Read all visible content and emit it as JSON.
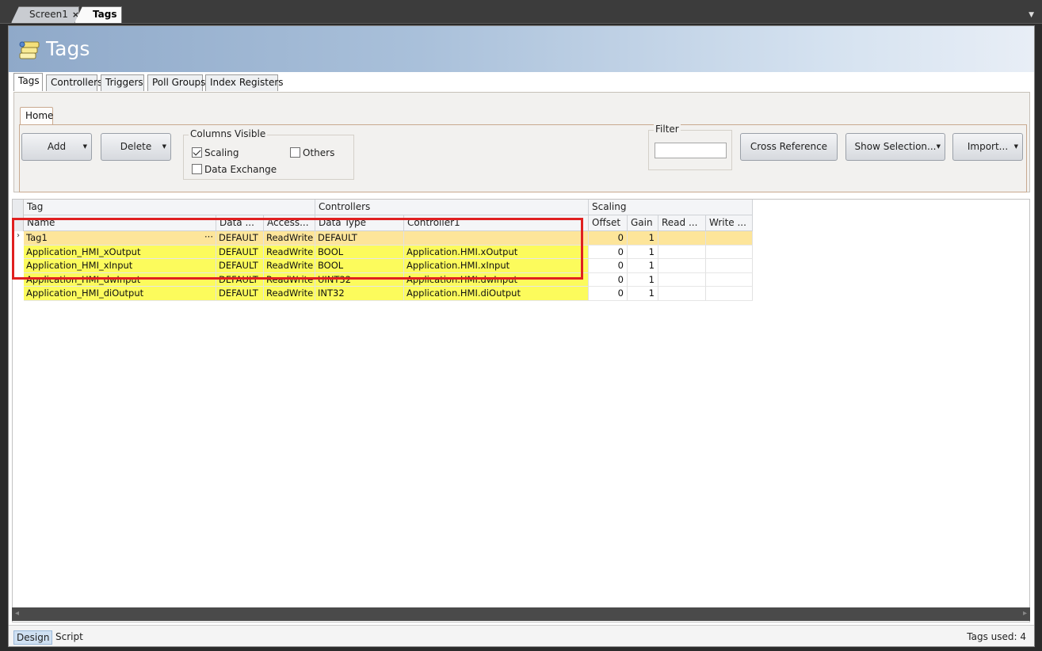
{
  "doc_tabs": [
    {
      "label": "Screen1",
      "close": "×"
    },
    {
      "label": "Tags",
      "close": "×"
    }
  ],
  "header": {
    "title": "Tags"
  },
  "inner_tabs": [
    "Tags",
    "Controllers",
    "Triggers",
    "Poll Groups",
    "Index Registers"
  ],
  "ribbon": {
    "tab": "Home",
    "add_label": "Add",
    "delete_label": "Delete",
    "columns_visible": {
      "label": "Columns Visible",
      "scaling": {
        "label": "Scaling",
        "checked": true
      },
      "others": {
        "label": "Others",
        "checked": false
      },
      "data_exchange": {
        "label": "Data Exchange",
        "checked": false
      }
    },
    "filter": {
      "label": "Filter",
      "value": ""
    },
    "cross_reference_label": "Cross Reference",
    "show_selection_label": "Show Selection...",
    "import_label": "Import..."
  },
  "grid": {
    "groups": [
      "Tag",
      "Controllers",
      "Scaling"
    ],
    "columns": [
      "Name",
      "Data ...",
      "Access...",
      "Data Type",
      "Controller1",
      "Offset",
      "Gain",
      "Read ...",
      "Write ..."
    ],
    "rows": [
      {
        "name": "Tag1",
        "data": "DEFAULT",
        "access": "ReadWrite",
        "dtype": "DEFAULT",
        "ctrl": "",
        "offset": "0",
        "gain": "1",
        "read": "",
        "write": "",
        "current": true,
        "indicator": "›",
        "ellipsis": "···"
      },
      {
        "name": "Application_HMI_xOutput",
        "data": "DEFAULT",
        "access": "ReadWrite",
        "dtype": "BOOL",
        "ctrl": "Application.HMI.xOutput",
        "offset": "0",
        "gain": "1",
        "read": "",
        "write": ""
      },
      {
        "name": "Application_HMI_xInput",
        "data": "DEFAULT",
        "access": "ReadWrite",
        "dtype": "BOOL",
        "ctrl": "Application.HMI.xInput",
        "offset": "0",
        "gain": "1",
        "read": "",
        "write": ""
      },
      {
        "name": "Application_HMI_dwInput",
        "data": "DEFAULT",
        "access": "ReadWrite",
        "dtype": "UINT32",
        "ctrl": "Application.HMI.dwInput",
        "offset": "0",
        "gain": "1",
        "read": "",
        "write": ""
      },
      {
        "name": "Application_HMI_diOutput",
        "data": "DEFAULT",
        "access": "ReadWrite",
        "dtype": "INT32",
        "ctrl": "Application.HMI.diOutput",
        "offset": "0",
        "gain": "1",
        "read": "",
        "write": ""
      }
    ]
  },
  "status": {
    "tabs": [
      "Design",
      "Script"
    ],
    "tags_used": "Tags used: 4"
  },
  "colors": {
    "current_row": "#fde59a",
    "highlight_row": "#fcfb5c",
    "highlight_border": "#e02020",
    "header_gradient_start": "#8fa9c9"
  }
}
